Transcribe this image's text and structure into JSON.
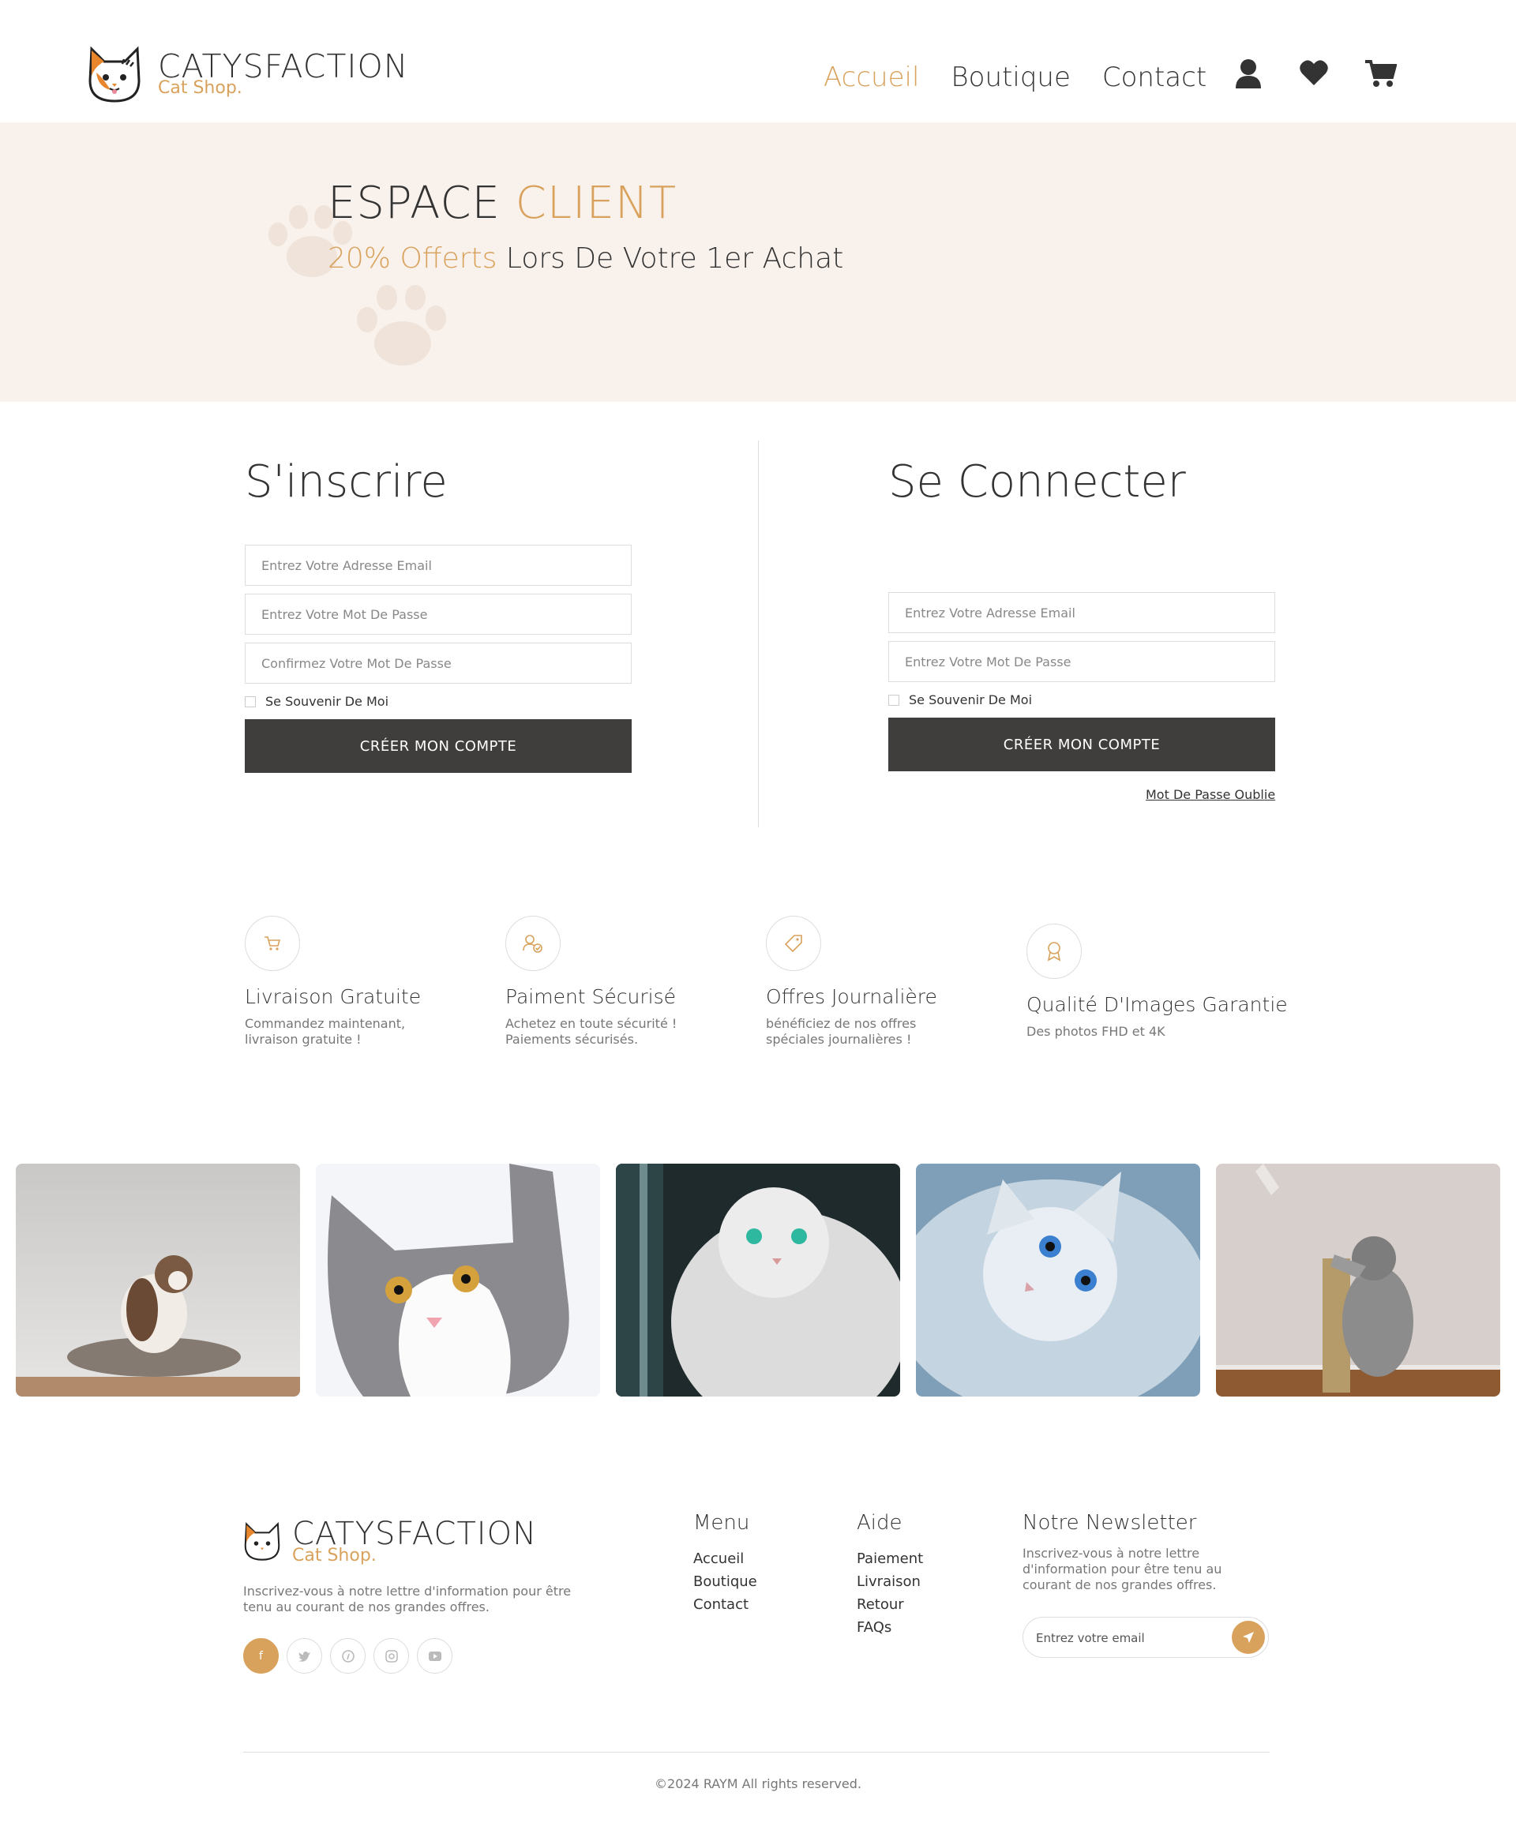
{
  "brand": {
    "name": "CATYSFACTION",
    "tagline": "Cat Shop."
  },
  "nav": {
    "items": [
      "Accueil",
      "Boutique",
      "Contact"
    ],
    "active": "Accueil"
  },
  "header_icons": [
    "user-icon",
    "heart-icon",
    "cart-icon"
  ],
  "hero": {
    "title_main": "ESPACE",
    "title_accent": "CLIENT",
    "subtitle_accent": "20% Offerts",
    "subtitle_rest": "Lors De Votre 1er Achat"
  },
  "register": {
    "title": "S'inscrire",
    "email_placeholder": "Entrez Votre Adresse Email",
    "password_placeholder": "Entrez Votre Mot De Passe",
    "confirm_placeholder": "Confirmez Votre Mot De Passe",
    "remember_label": "Se Souvenir De Moi",
    "submit_label": "CRÉER MON COMPTE"
  },
  "login": {
    "title": "Se Connecter",
    "email_placeholder": "Entrez Votre Adresse Email",
    "password_placeholder": "Entrez Votre Mot De Passe",
    "remember_label": "Se Souvenir De Moi",
    "submit_label": "CRÉER MON COMPTE",
    "forgot_label": "Mot De Passe Oublie"
  },
  "features": [
    {
      "icon": "cart-icon",
      "title": "Livraison Gratuite",
      "desc_1": "Commandez maintenant,",
      "desc_2": "livraison gratuite !"
    },
    {
      "icon": "secure-payment-icon",
      "title": "Paiment Sécurisé",
      "desc_1": "Achetez en toute sécurité !",
      "desc_2": "Paiements sécurisés."
    },
    {
      "icon": "tag-icon",
      "title": "Offres Journalière",
      "desc_1": "bénéficiez de nos offres",
      "desc_2": "spéciales journalières !"
    },
    {
      "icon": "award-icon",
      "title": "Qualité D'Images Garantie",
      "desc_1": "Des photos FHD et 4K",
      "desc_2": ""
    }
  ],
  "gallery": [
    "cat-on-bed-photo",
    "grey-white-cat-photo",
    "white-persian-window-photo",
    "blue-eyed-cat-photo",
    "kitten-scratching-post-photo"
  ],
  "footer": {
    "description": "Inscrivez-vous à notre lettre d'information pour être tenu au courant de nos grandes offres.",
    "socials": [
      "f",
      "twitter-icon",
      "pinterest-icon",
      "instagram-icon",
      "youtube-icon"
    ],
    "menu": {
      "title": "Menu",
      "links": [
        "Accueil",
        "Boutique",
        "Contact"
      ]
    },
    "help": {
      "title": "Aide",
      "links": [
        "Paiement",
        "Livraison",
        "Retour",
        "FAQs"
      ]
    },
    "newsletter": {
      "title": "Notre Newsletter",
      "description": "Inscrivez-vous à notre lettre d'information pour être tenu au courant de nos grandes offres.",
      "placeholder": "Entrez votre email"
    },
    "copyright": "©2024 RAYM All rights reserved."
  },
  "colors": {
    "accent": "#d9a25c",
    "dark": "#3f3e3c",
    "hero_bg": "#f9f1eb"
  }
}
